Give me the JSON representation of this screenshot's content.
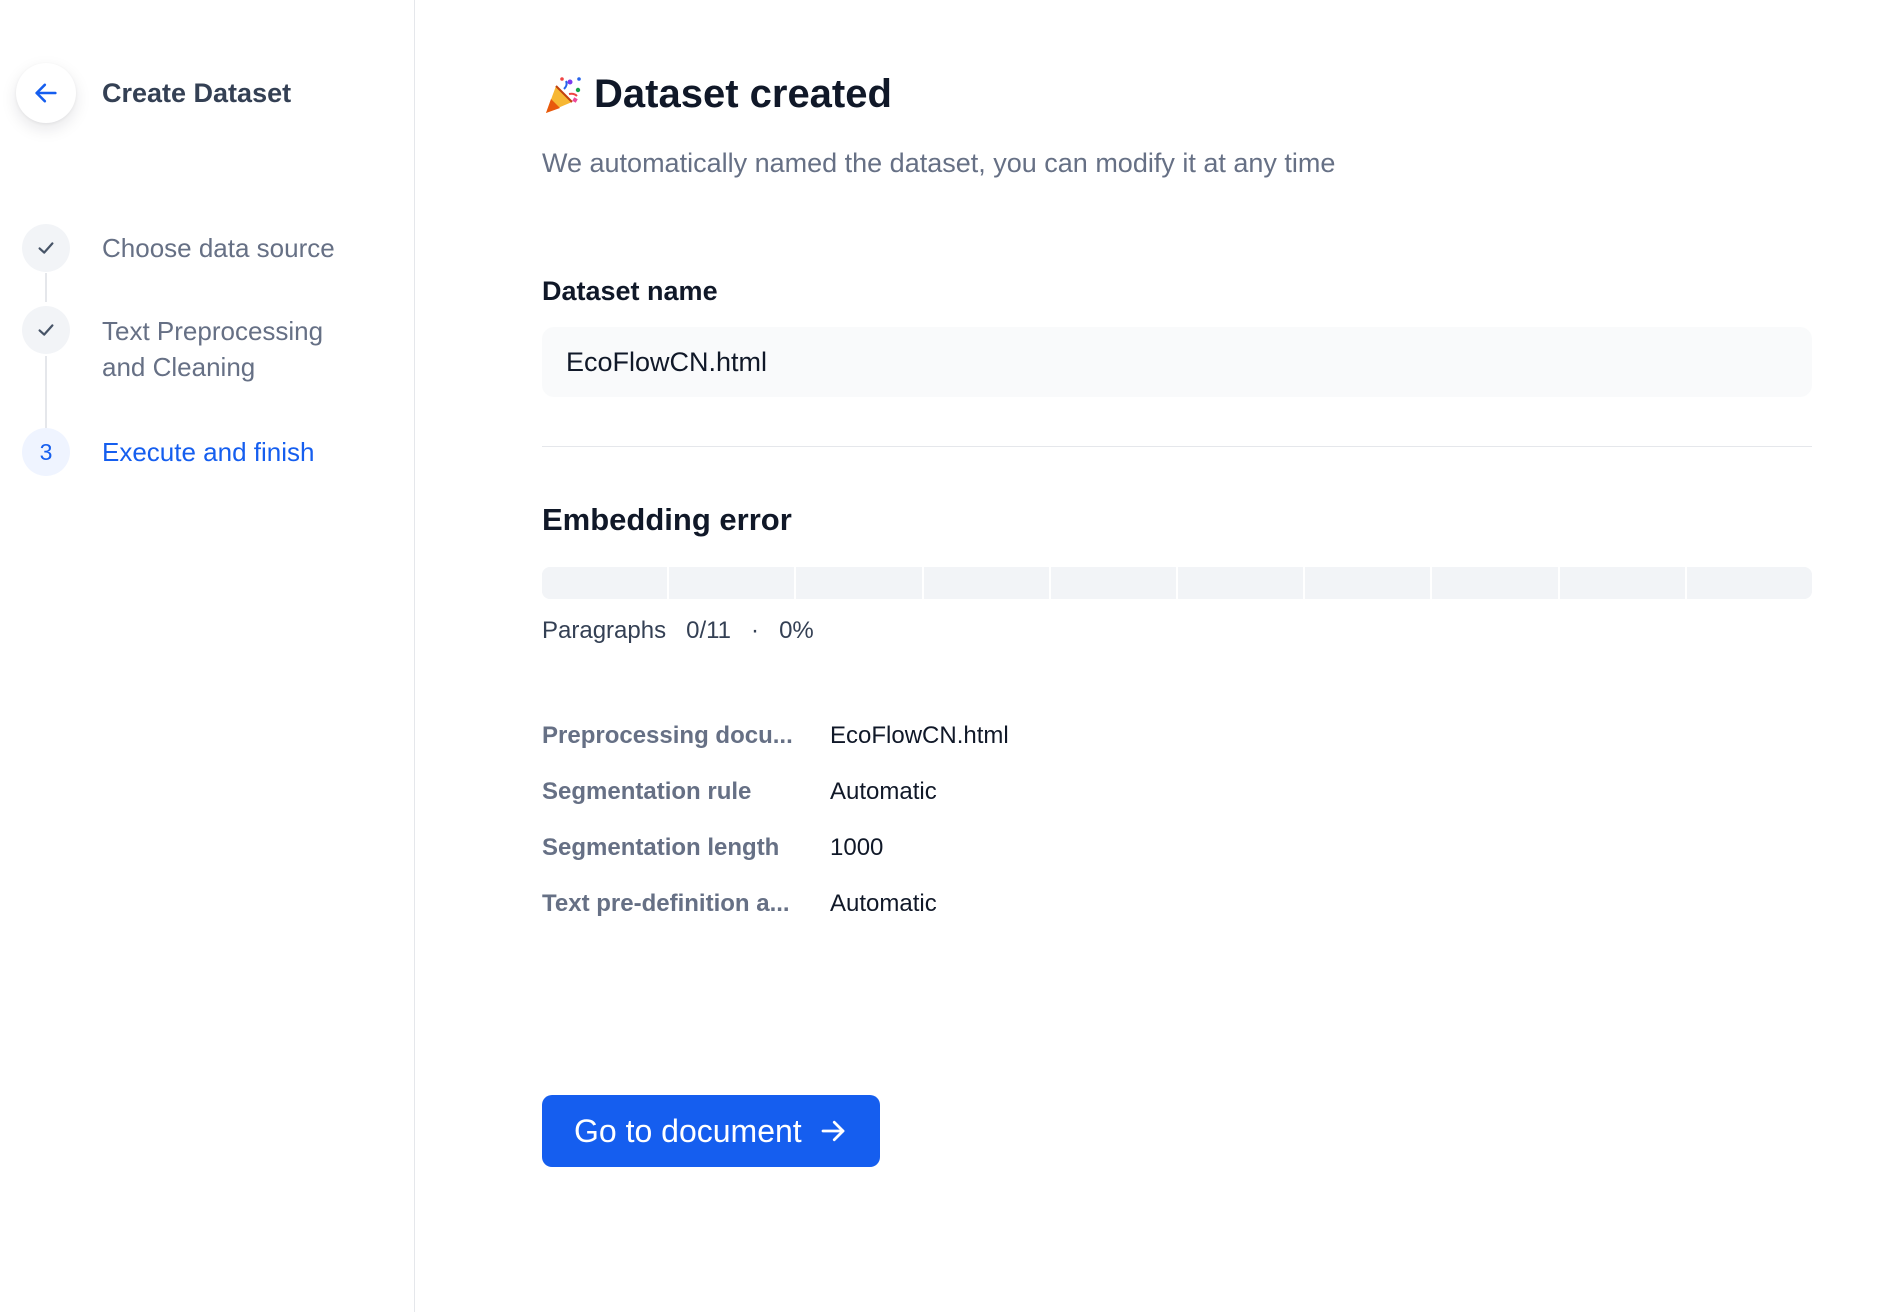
{
  "sidebar": {
    "title": "Create Dataset",
    "back_icon": "arrow-left-icon",
    "steps": [
      {
        "label": "Choose data source",
        "state": "done",
        "icon": "check-icon"
      },
      {
        "label": "Text Preprocessing and Cleaning",
        "state": "done",
        "icon": "check-icon"
      },
      {
        "label": "Execute and finish",
        "state": "active",
        "number": "3"
      }
    ]
  },
  "main": {
    "heading_icon": "party-popper-icon",
    "heading": "Dataset created",
    "subtitle": "We automatically named the dataset, you can modify it at any time",
    "name_field": {
      "label": "Dataset name",
      "value": "EcoFlowCN.html"
    },
    "embedding": {
      "title": "Embedding error",
      "progress_fraction": 0,
      "segment_count": 10,
      "paragraphs_label": "Paragraphs",
      "paragraphs_done": "0/11",
      "separator": "·",
      "percent": "0%"
    },
    "info": [
      {
        "key": "Preprocessing docu...",
        "value": "EcoFlowCN.html"
      },
      {
        "key": "Segmentation rule",
        "value": "Automatic"
      },
      {
        "key": "Segmentation length",
        "value": "1000"
      },
      {
        "key": "Text pre-definition a...",
        "value": "Automatic"
      }
    ],
    "go_button": {
      "label": "Go to document",
      "icon": "arrow-right-icon"
    }
  },
  "colors": {
    "primary": "#155eef",
    "text": "#101828",
    "muted": "#667085"
  }
}
